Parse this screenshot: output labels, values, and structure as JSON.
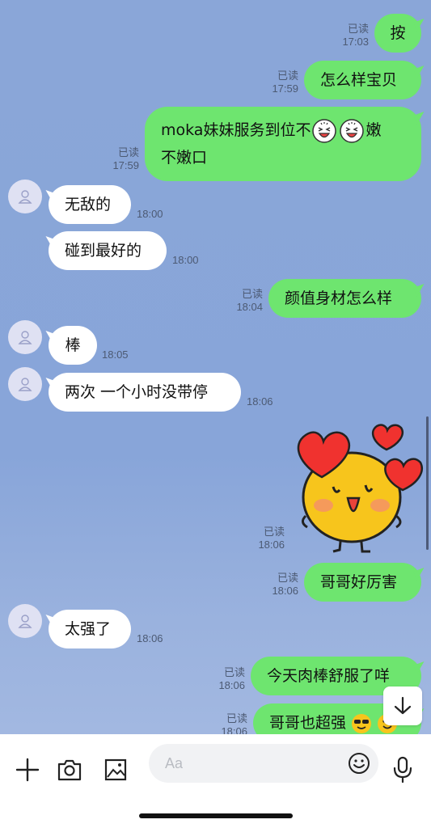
{
  "messages": [
    {
      "dir": "out",
      "text": "按",
      "read": "已读",
      "time": "17:03"
    },
    {
      "dir": "out",
      "text": "怎么样宝贝",
      "read": "已读",
      "time": "17:59"
    },
    {
      "dir": "out",
      "text_a": "moka妹妹服务到位不",
      "text_b": "嫩",
      "text_c": "不嫩口",
      "read": "已读",
      "time": "17:59"
    },
    {
      "dir": "in",
      "text": "无敌的",
      "time": "18:00"
    },
    {
      "dir": "in",
      "text": "碰到最好的",
      "time": "18:00"
    },
    {
      "dir": "out",
      "text": "颜值身材怎么样",
      "read": "已读",
      "time": "18:04"
    },
    {
      "dir": "in",
      "text": "棒",
      "time": "18:05"
    },
    {
      "dir": "in",
      "text": "两次 一个小时没带停",
      "time": "18:06"
    },
    {
      "dir": "out",
      "sticker": "smiley-hearts-sticker",
      "read": "已读",
      "time": "18:06"
    },
    {
      "dir": "out",
      "text": "哥哥好厉害",
      "read": "已读",
      "time": "18:06"
    },
    {
      "dir": "in",
      "text": "太强了",
      "time": "18:06"
    },
    {
      "dir": "out",
      "text": "今天肉棒舒服了咩",
      "read": "已读",
      "time": "18:06"
    },
    {
      "dir": "out",
      "text": "哥哥也超强",
      "read": "已读",
      "time": "18:06"
    }
  ],
  "input": {
    "placeholder": "Aa"
  },
  "icons": {
    "add": "plus-icon",
    "camera": "camera-icon",
    "gallery": "image-icon",
    "emoji": "emoji-icon",
    "mic": "microphone-icon",
    "scroll_down": "arrow-down-icon"
  },
  "colors": {
    "out_bubble": "#6ee56f",
    "in_bubble": "#ffffff",
    "background": "#88a5d9"
  }
}
